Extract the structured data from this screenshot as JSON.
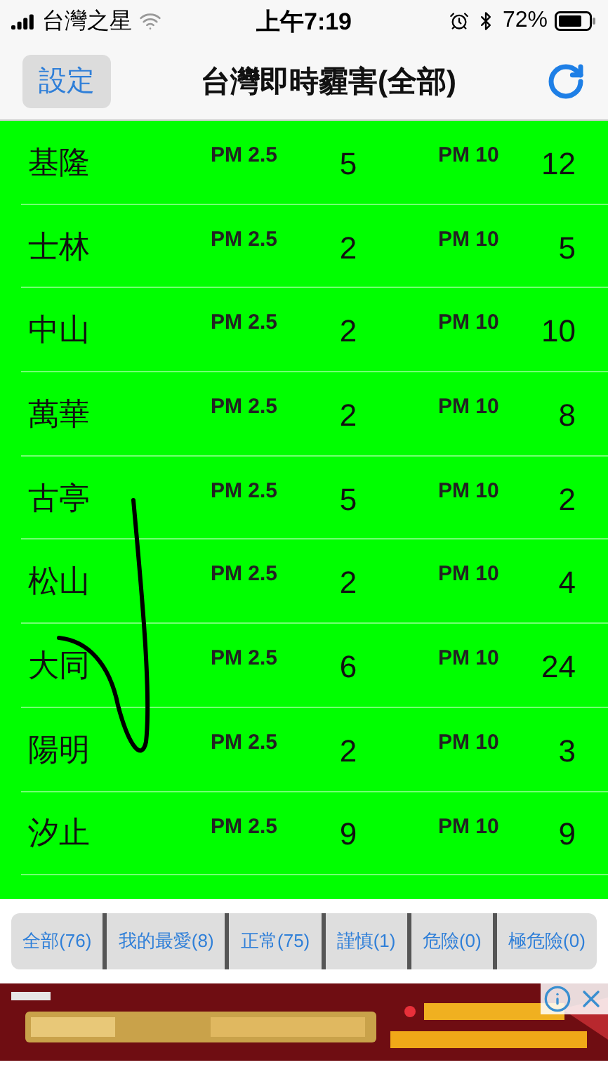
{
  "status_bar": {
    "carrier": "台灣之星",
    "time": "上午7:19",
    "battery": "72%"
  },
  "nav": {
    "left_button": "設定",
    "title": "台灣即時霾害(全部)"
  },
  "stations": [
    {
      "name": "基隆",
      "pm25_label": "PM 2.5",
      "pm25": "5",
      "pm10_label": "PM 10",
      "pm10": "12",
      "color": "#00ff00"
    },
    {
      "name": "士林",
      "pm25_label": "PM 2.5",
      "pm25": "2",
      "pm10_label": "PM 10",
      "pm10": "5",
      "color": "#00ff00"
    },
    {
      "name": "中山",
      "pm25_label": "PM 2.5",
      "pm25": "2",
      "pm10_label": "PM 10",
      "pm10": "10",
      "color": "#00ff00"
    },
    {
      "name": "萬華",
      "pm25_label": "PM 2.5",
      "pm25": "2",
      "pm10_label": "PM 10",
      "pm10": "8",
      "color": "#00ff00"
    },
    {
      "name": "古亭",
      "pm25_label": "PM 2.5",
      "pm25": "5",
      "pm10_label": "PM 10",
      "pm10": "2",
      "color": "#00ff00"
    },
    {
      "name": "松山",
      "pm25_label": "PM 2.5",
      "pm25": "2",
      "pm10_label": "PM 10",
      "pm10": "4",
      "color": "#00ff00"
    },
    {
      "name": "大同",
      "pm25_label": "PM 2.5",
      "pm25": "6",
      "pm10_label": "PM 10",
      "pm10": "24",
      "color": "#00ff00"
    },
    {
      "name": "陽明",
      "pm25_label": "PM 2.5",
      "pm25": "2",
      "pm10_label": "PM 10",
      "pm10": "3",
      "color": "#00ff00"
    },
    {
      "name": "汐止",
      "pm25_label": "PM 2.5",
      "pm25": "9",
      "pm10_label": "PM 10",
      "pm10": "9",
      "color": "#00ff00"
    }
  ],
  "filters": [
    "全部(76)",
    "我的最愛(8)",
    "正常(75)",
    "謹慎(1)",
    "危險(0)",
    "極危險(0)"
  ]
}
